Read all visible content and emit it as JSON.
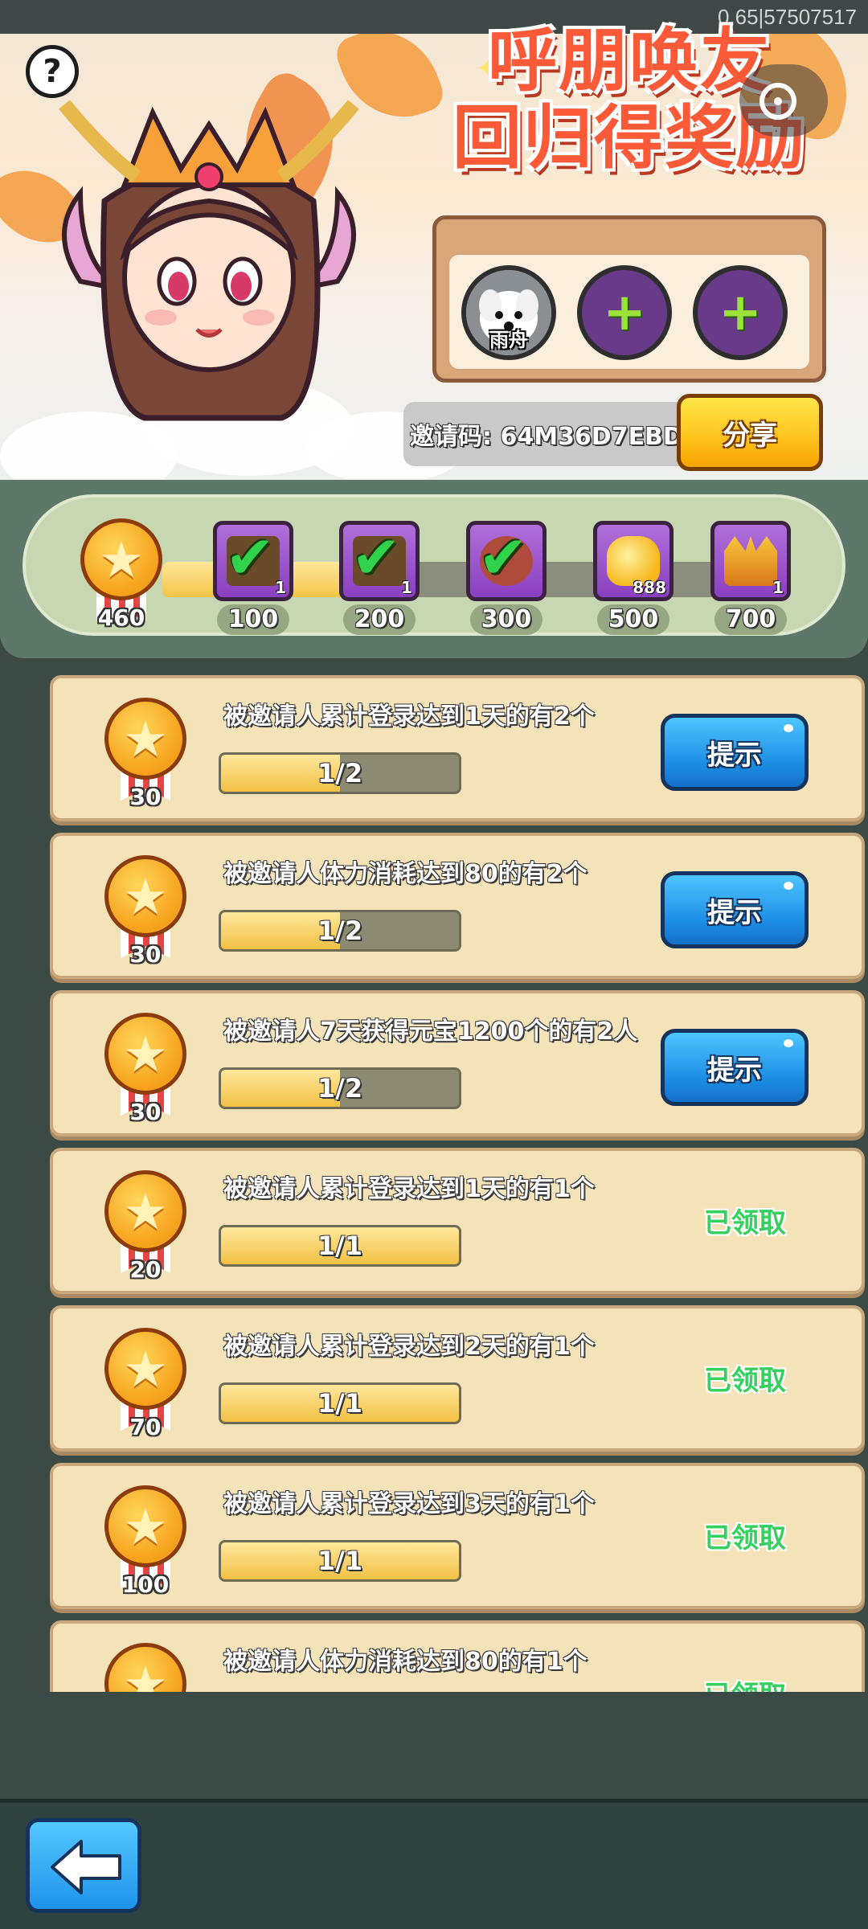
{
  "debug_id": "0,65|57507517",
  "banner": {
    "title_line1": "呼朋唤友",
    "title_line2": "回归得奖励",
    "help_symbol": "?"
  },
  "friends": {
    "slots": [
      {
        "type": "friend",
        "name": "雨舟"
      },
      {
        "type": "empty",
        "icon": "plus-icon"
      },
      {
        "type": "empty",
        "icon": "plus-icon"
      }
    ]
  },
  "invite": {
    "code_text": "邀请码: 64M36D7EBD",
    "share_label": "分享"
  },
  "milestones": {
    "current_points": "460",
    "progress_fraction": 0.43,
    "rewards": [
      {
        "threshold": "100",
        "count": "1",
        "icon": "chest-icon",
        "claimed": true
      },
      {
        "threshold": "200",
        "count": "1",
        "icon": "chest-icon",
        "claimed": true
      },
      {
        "threshold": "300",
        "count": "",
        "icon": "hero-portrait-icon",
        "claimed": true
      },
      {
        "threshold": "500",
        "count": "888",
        "icon": "gold-ingot-icon",
        "claimed": false
      },
      {
        "threshold": "700",
        "count": "1",
        "icon": "crown-icon",
        "claimed": false
      }
    ]
  },
  "tasks": [
    {
      "title": "被邀请人累计登录达到1天的有2个",
      "points": "30",
      "progress": "1/2",
      "fill": 0.5,
      "action": "提示",
      "state": "hint"
    },
    {
      "title": "被邀请人体力消耗达到80的有2个",
      "points": "30",
      "progress": "1/2",
      "fill": 0.5,
      "action": "提示",
      "state": "hint"
    },
    {
      "title": "被邀请人7天获得元宝1200个的有2人",
      "points": "30",
      "progress": "1/2",
      "fill": 0.5,
      "action": "提示",
      "state": "hint"
    },
    {
      "title": "被邀请人累计登录达到1天的有1个",
      "points": "20",
      "progress": "1/1",
      "fill": 1.0,
      "action": "已领取",
      "state": "claimed"
    },
    {
      "title": "被邀请人累计登录达到2天的有1个",
      "points": "70",
      "progress": "1/1",
      "fill": 1.0,
      "action": "已领取",
      "state": "claimed"
    },
    {
      "title": "被邀请人累计登录达到3天的有1个",
      "points": "100",
      "progress": "1/1",
      "fill": 1.0,
      "action": "已领取",
      "state": "claimed"
    },
    {
      "title": "被邀请人体力消耗达到80的有1个",
      "points": "",
      "progress": "",
      "fill": 1.0,
      "action": "已领取",
      "state": "claimed"
    }
  ],
  "colors": {
    "claimed_green": "#35d05f",
    "hint_blue": "#1d8fe6",
    "share_yellow": "#ffc21c",
    "title_red": "#fb5a39"
  },
  "bottom": {
    "back_icon": "back-arrow-icon"
  }
}
